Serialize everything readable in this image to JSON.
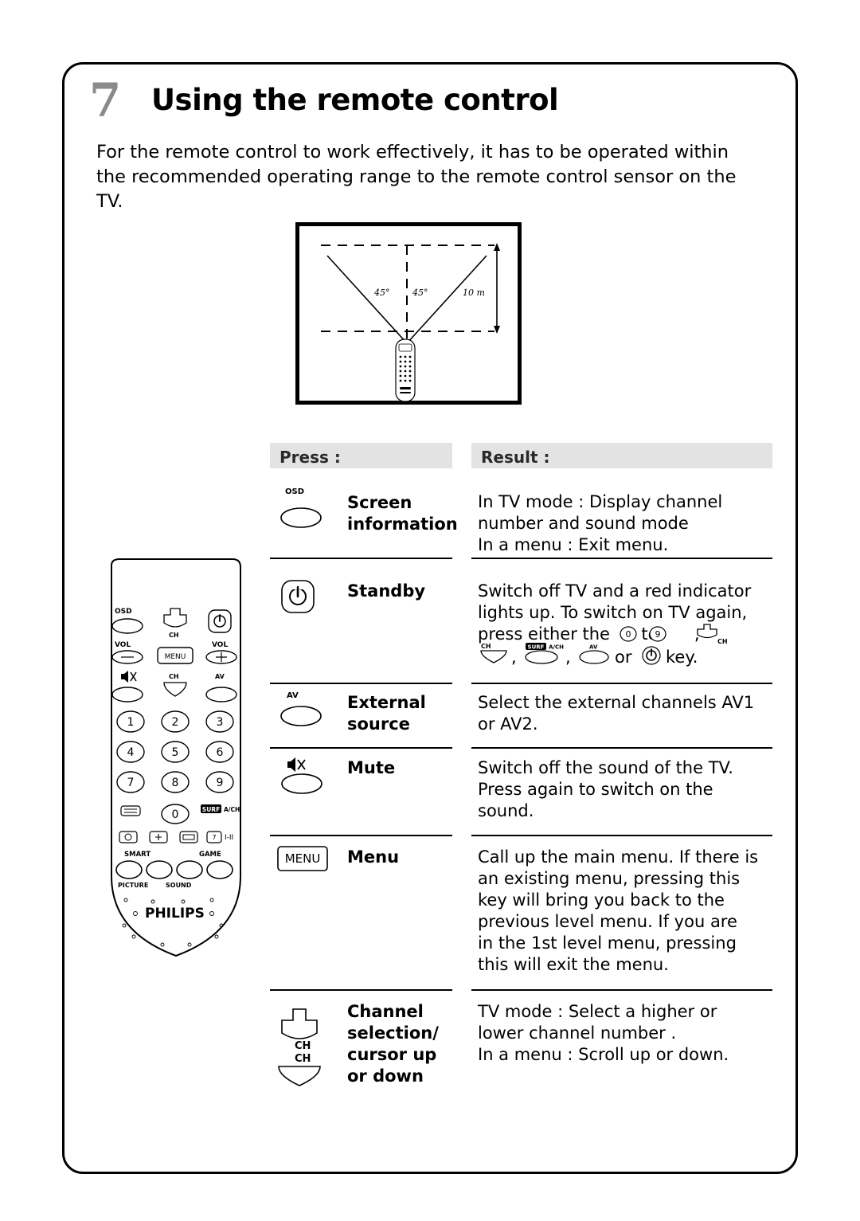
{
  "page": {
    "chapter_number": "7",
    "title": "Using the remote control",
    "intro": "For the remote control to work effectively, it has to be operated within the recommended operating range to the remote control sensor on the TV."
  },
  "range_diagram": {
    "angle_left": "45°",
    "angle_right": "45°",
    "distance": "10 m"
  },
  "table": {
    "headers": {
      "press": "Press :",
      "result": "Result :"
    },
    "rows": [
      {
        "icon": "osd-button-icon",
        "icon_label": "OSD",
        "label": "Screen information",
        "label_lines": [
          "Screen",
          "information"
        ],
        "result_lines": [
          "In TV mode : Display channel",
          "number and sound mode",
          "In a menu : Exit menu."
        ]
      },
      {
        "icon": "standby-power-icon",
        "icon_label": "",
        "label": "Standby",
        "label_lines": [
          "Standby"
        ],
        "result_lines": [
          "Switch off TV and a red indicator",
          "lights up.  To switch on TV again,",
          "press either the ⓪ to ⑨,",
          ", , or key."
        ],
        "inline_keys": [
          "0",
          "9",
          "CH+",
          "CH-",
          "SURF",
          "A/CH",
          "AV",
          "power"
        ]
      },
      {
        "icon": "av-button-icon",
        "icon_label": "AV",
        "label": "External source",
        "label_lines": [
          "External",
          "source"
        ],
        "result_lines": [
          "Select the external channels AV1",
          "or AV2."
        ]
      },
      {
        "icon": "mute-button-icon",
        "icon_label": "",
        "label": "Mute",
        "label_lines": [
          "Mute"
        ],
        "result_lines": [
          "Switch off the sound of the TV.",
          "Press again to switch on the",
          "sound."
        ]
      },
      {
        "icon": "menu-button-icon",
        "icon_label": "MENU",
        "label": "Menu",
        "label_lines": [
          "Menu"
        ],
        "result_lines": [
          "Call up the main menu. If there is",
          "an existing menu, pressing this",
          "key will bring you back to the",
          "previous level menu. If you are",
          "in the 1st level menu, pressing",
          "this will exit the menu."
        ]
      },
      {
        "icon": "channel-up-down-icon",
        "icon_label": "CH",
        "label": "Channel selection/ cursor up or down",
        "label_lines": [
          "Channel",
          "selection/",
          "cursor up",
          "or down"
        ],
        "result_lines": [
          "TV mode : Select a higher or",
          "lower channel number .",
          "In a menu : Scroll up or down."
        ]
      }
    ]
  },
  "remote": {
    "brand": "PHILIPS",
    "buttons": {
      "osd": "OSD",
      "vol_left": "VOL",
      "vol_right": "VOL",
      "menu": "MENU",
      "ch_up": "CH",
      "ch_down": "CH",
      "av": "AV",
      "numbers": [
        "1",
        "2",
        "3",
        "4",
        "5",
        "6",
        "7",
        "8",
        "9",
        "0"
      ],
      "surf": "SURF",
      "ach": "A/CH",
      "smart": "SMART",
      "game": "GAME",
      "picture": "PICTURE",
      "sound": "SOUND",
      "pip": "7",
      "sound_mode": "I-II"
    }
  }
}
